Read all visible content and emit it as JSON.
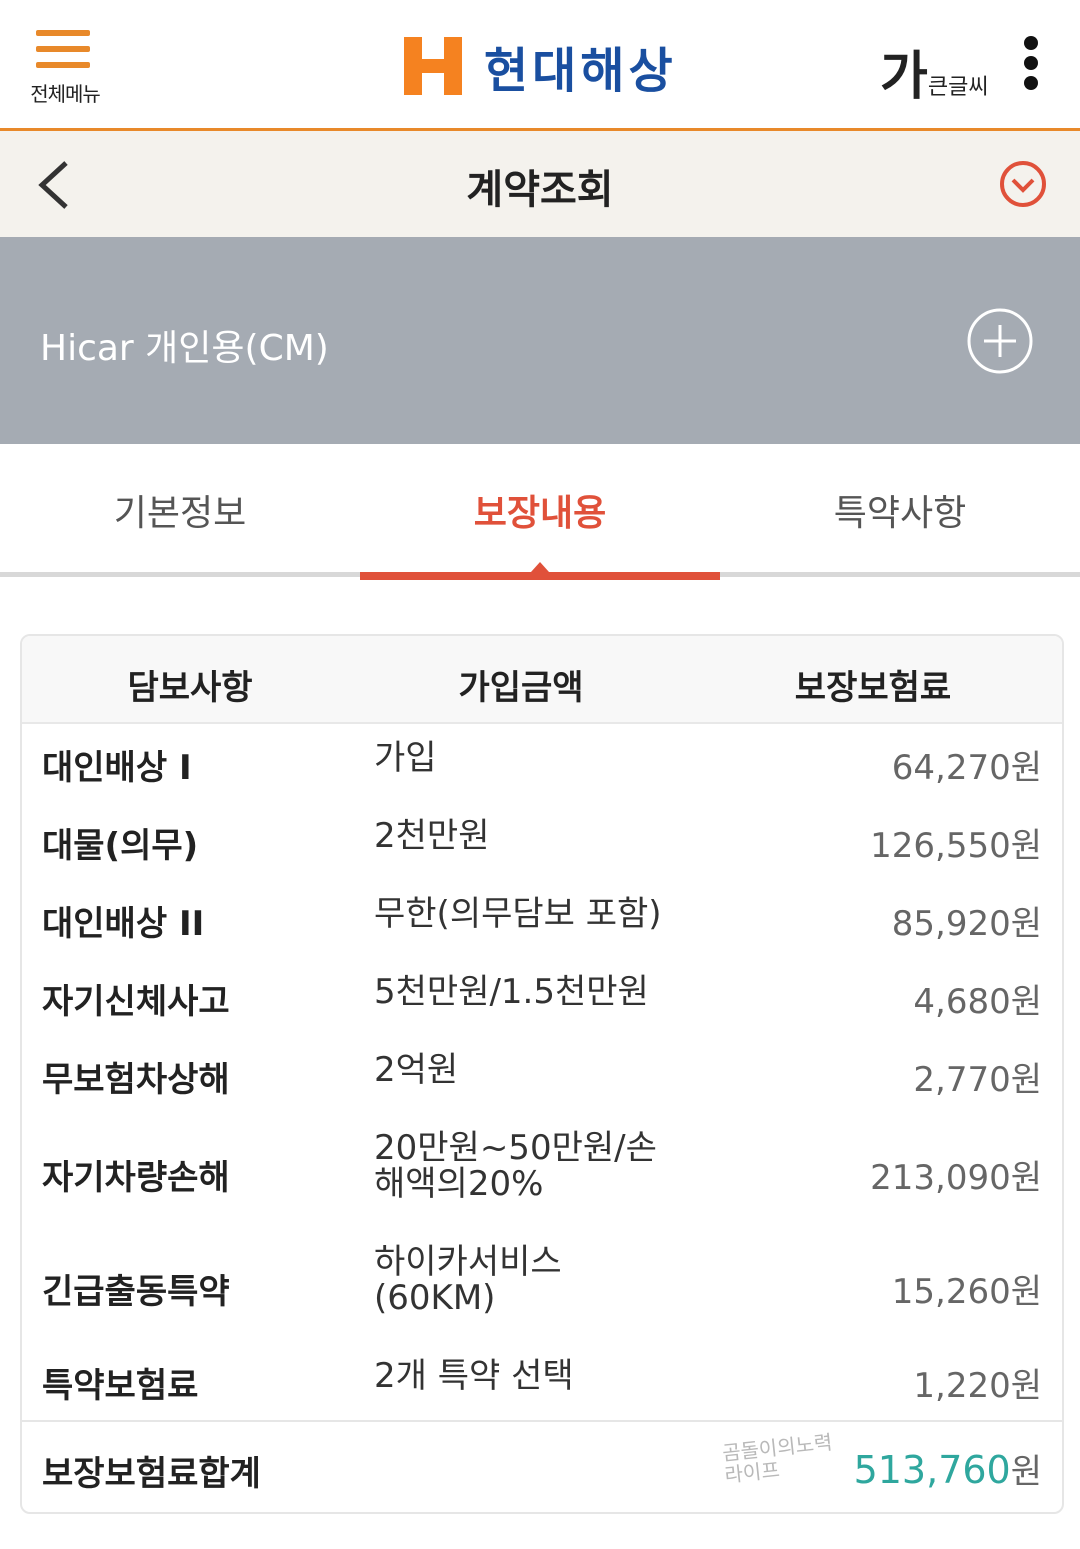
{
  "header": {
    "menu_label": "전체메뉴",
    "logo_text": "현대해상",
    "fontsize_big": "가",
    "fontsize_small": "큰글씨"
  },
  "subheader": {
    "title": "계약조회"
  },
  "product": {
    "name": "Hicar 개인용(CM)"
  },
  "tabs": [
    {
      "label": "기본정보",
      "active": false
    },
    {
      "label": "보장내용",
      "active": true
    },
    {
      "label": "특약사항",
      "active": false
    }
  ],
  "table": {
    "headers": [
      "담보사항",
      "가입금액",
      "보장보험료"
    ],
    "rows": [
      {
        "name": "대인배상 I",
        "amount": "가입",
        "premium": "64,270원"
      },
      {
        "name": "대물(의무)",
        "amount": "2천만원",
        "premium": "126,550원"
      },
      {
        "name": "대인배상 II",
        "amount": "무한(의무담보 포함)",
        "premium": "85,920원"
      },
      {
        "name": "자기신체사고",
        "amount": "5천만원/1.5천만원",
        "premium": "4,680원"
      },
      {
        "name": "무보험차상해",
        "amount": "2억원",
        "premium": "2,770원"
      },
      {
        "name": "자기차량손해",
        "amount": "20만원~50만원/손해액의20%",
        "premium": "213,090원"
      },
      {
        "name": "긴급출동특약",
        "amount": "하이카서비스(60KM)",
        "premium": "15,260원"
      },
      {
        "name": "특약보험료",
        "amount": "2개 특약 선택",
        "premium": "1,220원"
      }
    ],
    "total_label": "보장보험료합계",
    "total_value": "513,760",
    "total_unit": "원",
    "watermark": "곰돌이의노력라이프"
  },
  "colors": {
    "accent_orange": "#e8892a",
    "brand_blue": "#1a4fa0",
    "tab_active": "#e0513a",
    "total_teal": "#2fa79e"
  }
}
